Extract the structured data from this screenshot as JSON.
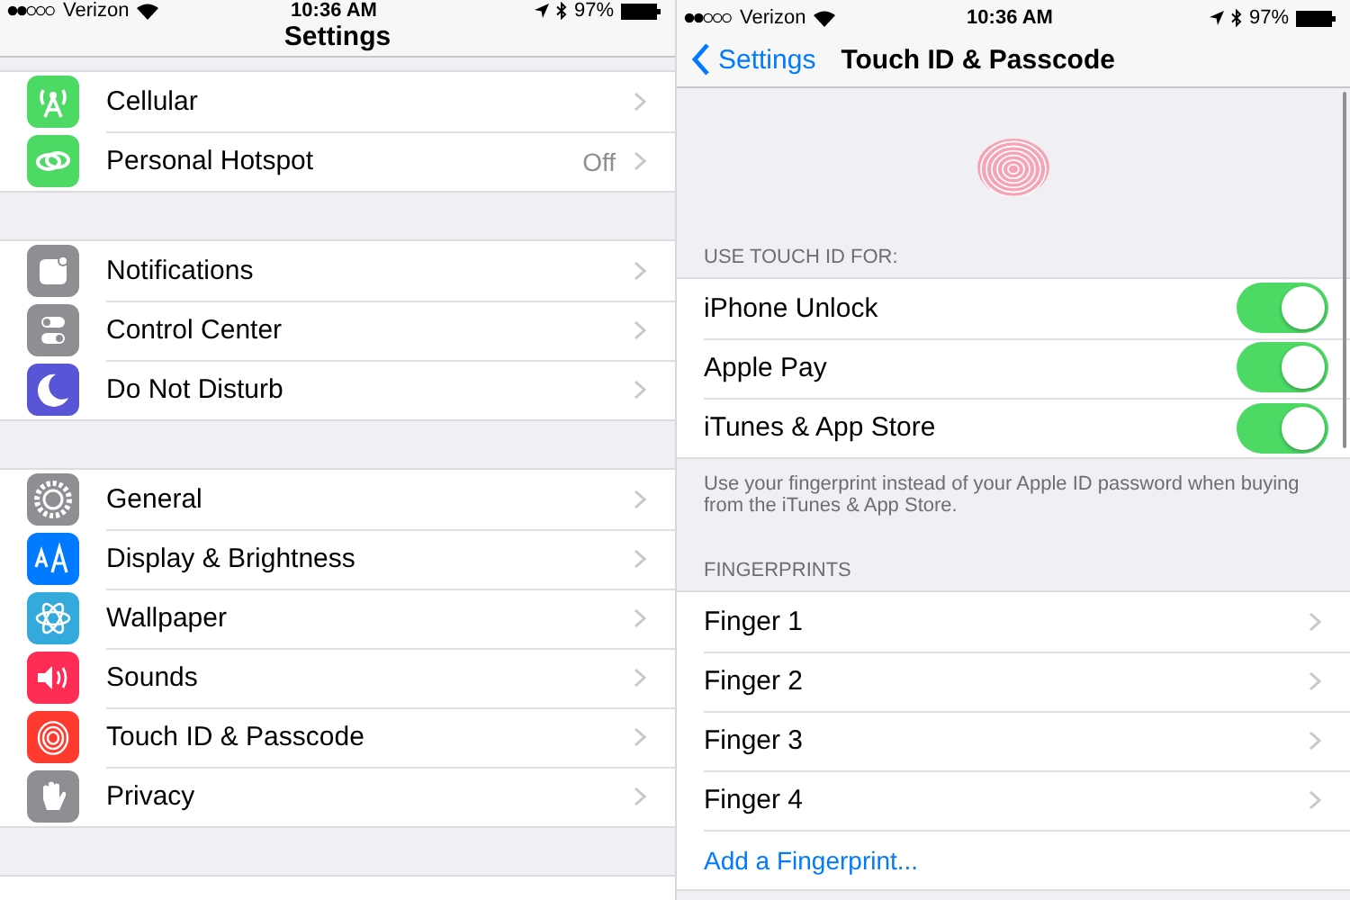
{
  "left": {
    "status_bar": {
      "carrier": "Verizon",
      "time": "10:36 AM",
      "battery": "97%"
    },
    "title": "Settings",
    "groups": [
      {
        "rows": [
          {
            "label": "Cellular"
          },
          {
            "label": "Personal Hotspot",
            "value": "Off"
          }
        ]
      },
      {
        "rows": [
          {
            "label": "Notifications"
          },
          {
            "label": "Control Center"
          },
          {
            "label": "Do Not Disturb"
          }
        ]
      },
      {
        "rows": [
          {
            "label": "General"
          },
          {
            "label": "Display & Brightness"
          },
          {
            "label": "Wallpaper"
          },
          {
            "label": "Sounds"
          },
          {
            "label": "Touch ID & Passcode"
          },
          {
            "label": "Privacy"
          }
        ]
      }
    ]
  },
  "right": {
    "status_bar": {
      "carrier": "Verizon",
      "time": "10:36 AM",
      "battery": "97%"
    },
    "back": "Settings",
    "title": "Touch ID & Passcode",
    "use_header": "USE TOUCH ID FOR:",
    "toggles": [
      {
        "label": "iPhone Unlock",
        "on": true
      },
      {
        "label": "Apple Pay",
        "on": true
      },
      {
        "label": "iTunes & App Store",
        "on": true
      }
    ],
    "footer": "Use your fingerprint instead of your Apple ID password when buying from the iTunes & App Store.",
    "fingerprints_header": "FINGERPRINTS",
    "fingers": [
      {
        "label": "Finger 1"
      },
      {
        "label": "Finger 2"
      },
      {
        "label": "Finger 3"
      },
      {
        "label": "Finger 4"
      }
    ],
    "add": "Add a Fingerprint..."
  }
}
